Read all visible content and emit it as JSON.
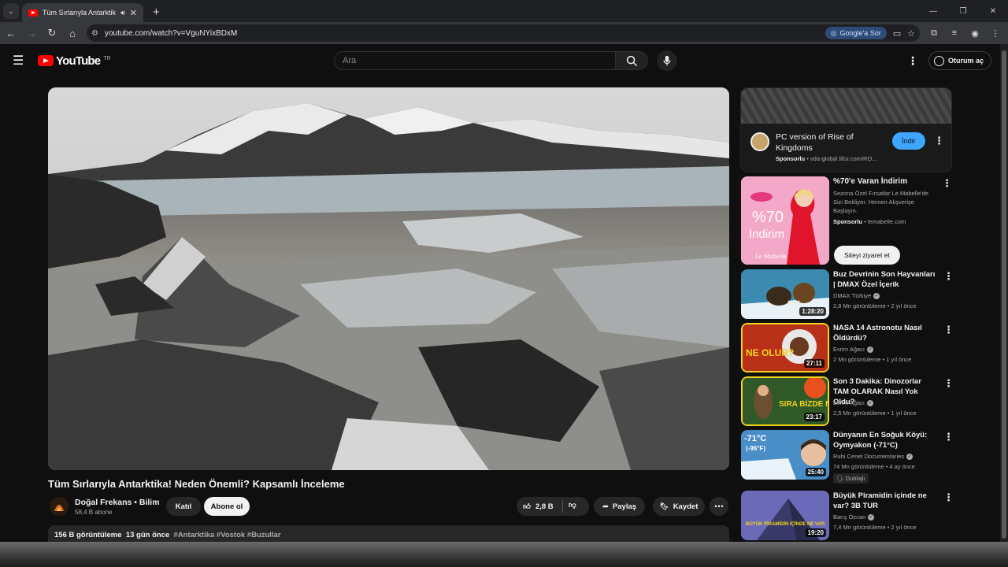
{
  "browser": {
    "tab_title": "Tüm Sırlarıyla Antarktikal N",
    "url": "youtube.com/watch?v=VguNYixBDxM",
    "ask_google_label": "Google'a Sor"
  },
  "youtube": {
    "logo_text": "YouTube",
    "region": "TR",
    "search_placeholder": "Ara",
    "signin_label": "Oturum aç"
  },
  "video": {
    "title": "Tüm Sırlarıyla Antarktika! Neden Önemli? Kapsamlı İnceleme",
    "channel_name": "Doğal Frekans • Bilim",
    "subscribers": "58,4 B abone",
    "join_label": "Katıl",
    "subscribe_label": "Abone ol",
    "likes": "2,8 B",
    "share_label": "Paylaş",
    "save_label": "Kaydet",
    "views": "156 B görüntüleme",
    "age": "13 gün önce",
    "hashtags": "#Antarktika #Vostok #Buzullar"
  },
  "ad": {
    "title": "PC version of Rise of Kingdoms",
    "sponsored": "Sponsorlu",
    "domain": "• vda-global.lilisi.com/RO...",
    "install_label": "İndir"
  },
  "promo": {
    "title": "%70'e Varan İndirim",
    "description": "Sezona Özel Fırsatlar Le Mabelle'de Sizi Bekliyor. Hemen Alışverişe Başlayın.",
    "sponsored": "Sponsorlu",
    "domain": "• lemabelle.com",
    "visit_label": "Siteyi ziyaret et",
    "image_text_pct": "%70",
    "image_text_word": "İndirim",
    "image_brand": "Le Mabelle"
  },
  "recommendations": [
    {
      "title": "Buz Devrinin Son Hayvanları | DMAX Özel İçerik",
      "channel": "DMAX Türkiye",
      "meta": "2,8 Mn görüntüleme • 2 yıl önce",
      "duration": "1:28:20"
    },
    {
      "title": "NASA 14 Astronotu Nasıl Öldürdü?",
      "channel": "Evrim Ağacı",
      "meta": "2 Mn görüntüleme • 1 yıl önce",
      "duration": "27:11"
    },
    {
      "title": "Son 3 Dakika: Dinozorlar TAM OLARAK Nasıl Yok Oldu?",
      "channel": "Evrim Ağacı",
      "meta": "2,5 Mn görüntüleme • 1 yıl önce",
      "duration": "23:17"
    },
    {
      "title": "Dünyanın En Soğuk Köyü: Oymyakon (-71°C)",
      "channel": "Ruhi Cenet Documentaries",
      "meta": "74 Mn görüntüleme • 4 ay önce",
      "duration": "25:40",
      "badge": "Dublajlı"
    },
    {
      "title": "Büyük Piramidin içinde ne var? 3B TUR",
      "channel": "Barış Özcan",
      "meta": "7,4 Mn görüntüleme • 2 yıl önce",
      "duration": "19:20"
    }
  ],
  "thumb_texts": {
    "nasa": "NE OLUR?",
    "dino": "SIRA BİZDE Mİ?",
    "cold_1": "-71°C",
    "cold_2": "(-96°F)",
    "pyramid": "BÜYÜK PİRAMİDİN İÇİNDE NE VAR"
  },
  "colors": {
    "accent_blue": "#3ea6ff",
    "brand_red": "#ff0000",
    "background": "#0f0f0f"
  }
}
